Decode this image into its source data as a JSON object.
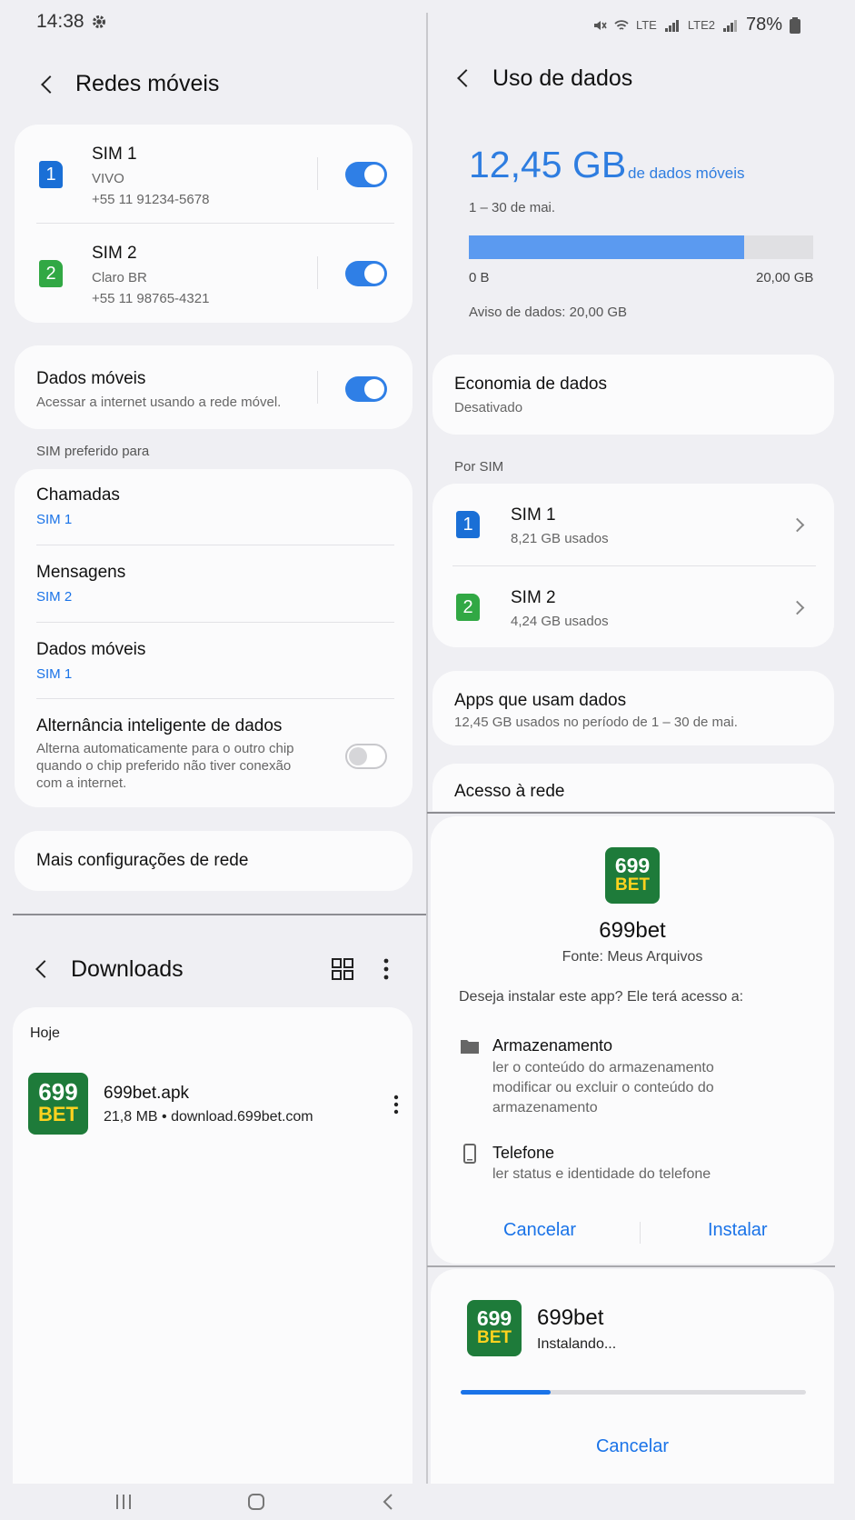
{
  "status": {
    "time": "14:38",
    "battery": "78%",
    "signal_labels": [
      "LTE",
      "LTE2"
    ]
  },
  "left": {
    "header": {
      "title": "Redes móveis"
    },
    "sims": [
      {
        "badge": "1",
        "name": "SIM 1",
        "carrier": "VIVO",
        "number": "+55 11 91234-5678",
        "enabled": true
      },
      {
        "badge": "2",
        "name": "SIM 2",
        "carrier": "Claro BR",
        "number": "+55 11 98765-4321",
        "enabled": true
      }
    ],
    "mobile_data": {
      "title": "Dados móveis",
      "subtitle": "Acessar a internet usando a rede móvel.",
      "enabled": true
    },
    "preferred_label": "SIM preferido para",
    "preferred": [
      {
        "title": "Chamadas",
        "value": "SIM 1"
      },
      {
        "title": "Mensagens",
        "value": "SIM 2"
      },
      {
        "title": "Dados móveis",
        "value": "SIM 1"
      }
    ],
    "smart_switch": {
      "title": "Alternância inteligente de dados",
      "subtitle": [
        "Alterna automaticamente para o outro chip",
        "quando o chip preferido não tiver conexão",
        "com a internet."
      ],
      "enabled": false
    },
    "more": "Mais configurações de rede"
  },
  "downloads": {
    "title": "Downloads",
    "section": "Hoje",
    "file": {
      "name": "699bet.apk",
      "meta": "21,8 MB • download.699bet.com",
      "logo_top": "699",
      "logo_bottom": "BET"
    }
  },
  "right": {
    "header": {
      "title": "Uso de dados"
    },
    "usage": {
      "amount": "12,45 GB",
      "label": "de dados móveis",
      "period": "1 – 30 de mai.",
      "min": "0 B",
      "max": "20,00 GB",
      "fraction": 0.8,
      "warning": "Aviso de dados: 20,00 GB"
    },
    "saver": {
      "title": "Economia de dados",
      "status": "Desativado"
    },
    "by_sim_label": "Por SIM",
    "by_sim": [
      {
        "badge": "1",
        "name": "SIM 1",
        "used": "8,21 GB usados"
      },
      {
        "badge": "2",
        "name": "SIM 2",
        "used": "4,24 GB usados"
      }
    ],
    "apps": {
      "title": "Apps que usam dados",
      "subtitle": "12,45 GB usados no período de 1 – 30 de mai."
    },
    "network_access": "Acesso à rede"
  },
  "install_dialog": {
    "app_name": "699bet",
    "source": "Fonte: Meus Arquivos",
    "question": "Deseja instalar este app? Ele terá acesso a:",
    "perm1": {
      "title": "Armazenamento",
      "lines": [
        "ler o conteúdo do armazenamento",
        "modificar ou excluir o conteúdo do",
        "armazenamento"
      ]
    },
    "perm2": {
      "title": "Telefone",
      "lines": [
        "ler status e identidade do telefone"
      ]
    },
    "cancel": "Cancelar",
    "install": "Instalar",
    "logo_top": "699",
    "logo_bottom": "BET"
  },
  "installing": {
    "app_name": "699bet",
    "status": "Instalando...",
    "progress": 0.26,
    "cancel": "Cancelar",
    "logo_top": "699",
    "logo_bottom": "BET"
  },
  "colors": {
    "accent": "#1a73e8",
    "toggle_on": "#2f7fe6",
    "usage_bar": "#5b9af0",
    "sim1": "#1a6fd6",
    "sim2": "#31a844",
    "bet_green": "#1e7b3a",
    "bet_yellow": "#ffd21f"
  }
}
